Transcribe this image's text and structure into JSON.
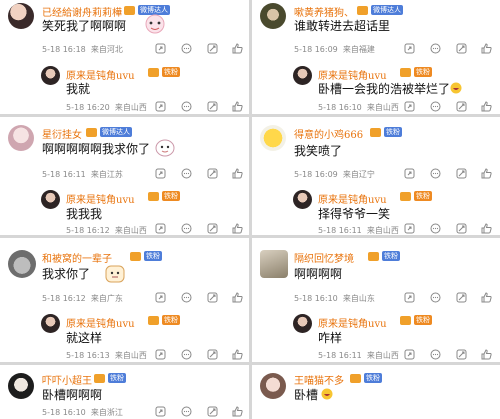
{
  "comments": [
    {
      "user": "已经給谢舟莉莉樺",
      "badge": "微博达人",
      "text": "笑死我了啊啊啊",
      "time": "5-18 16:18",
      "location": "来自河北",
      "reply": {
        "user": "原来是钝角uvu",
        "badge": "铁粉",
        "text": "我就",
        "time": "5-18 16:20",
        "location": "来自山西"
      }
    },
    {
      "user": "嗽黄养猪狗、",
      "badge": "微博达人",
      "text": "谁敢转进去超话里",
      "time": "5-18 16:09",
      "location": "来自福建",
      "reply": {
        "user": "原来是钝角uvu",
        "badge": "铁粉",
        "text": "卧槽一会我的浩被举烂了",
        "time": "5-18 16:10",
        "location": "来自山西"
      }
    },
    {
      "user": "星衍挂女",
      "badge": "微博达人",
      "text": "啊啊啊啊啊我求你了",
      "time": "5-18 16:11",
      "location": "来自江苏",
      "reply": {
        "user": "原来是钝角uvu",
        "badge": "铁粉",
        "text": "我我我",
        "time": "5-18 16:12",
        "location": "来自山西"
      }
    },
    {
      "user": "得意的小鸡666",
      "badge": "铁粉",
      "text": "我笑喷了",
      "time": "5-18 16:09",
      "location": "来自辽宁",
      "reply": {
        "user": "原来是钝角uvu",
        "badge": "铁粉",
        "text": "择得爷爷一笑",
        "time": "5-18 16:11",
        "location": "来自山西"
      }
    },
    {
      "user": "和被窝的一辈子",
      "badge": "铁粉",
      "text": "我求你了",
      "time": "5-18 16:12",
      "location": "来自广东",
      "reply": {
        "user": "原来是钝角uvu",
        "badge": "铁粉",
        "text": "就这样",
        "time": "5-18 16:13",
        "location": "来自山西"
      }
    },
    {
      "user": "隔织回忆梦境",
      "badge": "铁粉",
      "text": "啊啊啊啊",
      "time": "5-18 16:10",
      "location": "来自山东",
      "reply": {
        "user": "原来是钝角uvu",
        "badge": "铁粉",
        "text": "咋样",
        "time": "5-18 16:11",
        "location": "来自山西"
      }
    },
    {
      "user": "吓吓小超王",
      "badge": "铁粉",
      "text": "卧槽啊啊啊",
      "time": "5-18 16:10",
      "location": "来自浙江"
    },
    {
      "user": "王喵猫不多",
      "badge": "铁粉",
      "text": "卧槽",
      "time": "",
      "location": ""
    }
  ],
  "icons": [
    "share-icon",
    "comment-icon",
    "like-icon",
    "more-icon"
  ],
  "colors": {
    "username": "#e8730c",
    "meta": "#8a8a8a",
    "badge_blue": "#4e7dd9",
    "badge_orange": "#ee8a22",
    "divider": "#d6d6d6"
  }
}
